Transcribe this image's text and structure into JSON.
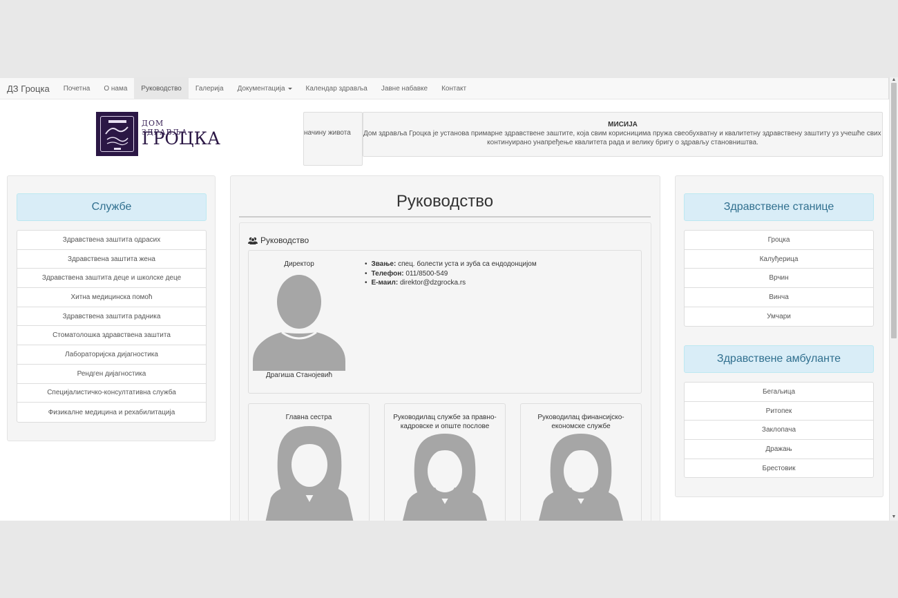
{
  "navbar": {
    "brand": "ДЗ Гроцка",
    "items": [
      {
        "label": "Почетна"
      },
      {
        "label": "О нама"
      },
      {
        "label": "Руководство"
      },
      {
        "label": "Галерија"
      },
      {
        "label": "Документација"
      },
      {
        "label": "Календар здравља"
      },
      {
        "label": "Јавне набавке"
      },
      {
        "label": "Контакт"
      }
    ],
    "active_index": 2
  },
  "logo": {
    "line1": "ДОМ ЗДРАВЉА",
    "line2": "ГРОЦКА"
  },
  "ticker": {
    "text": "начину живота"
  },
  "mission": {
    "title": "МИСИЈА",
    "line1": "Дом здравља Гроцка је установа примарне здравствене заштите, која свим корисницима пружа свеобухватну и квалитетну здравствену заштиту уз учешће свих посто",
    "line2": "континуирано унапређење квалитета рада и велику бригу о здрављу становништва."
  },
  "services": {
    "title": "Службе",
    "items": [
      {
        "label": "Здравствена заштита одрасих"
      },
      {
        "label": "Здравствена заштита жена"
      },
      {
        "label": "Здравствена заштита деце и школске деце"
      },
      {
        "label": "Хитна медицинска помоћ"
      },
      {
        "label": "Здравствена заштита радника"
      },
      {
        "label": "Стоматолошка здравствена заштита"
      },
      {
        "label": "Лабораторијска дијагностика"
      },
      {
        "label": "Рендген дијагностика"
      },
      {
        "label": "Специјалистичко-консултативна служба"
      },
      {
        "label": "Физикалне медицина и рехабилитација"
      }
    ]
  },
  "main": {
    "title": "Руководство",
    "section_title": "Руководство",
    "director": {
      "role": "Директор",
      "name": "Драгиша Станојевић",
      "rank_label": "Звање:",
      "rank": "спец. болести уста и зуба са ендодонцијом",
      "phone_label": "Телефон:",
      "phone": "011/8500-549",
      "email_label": "E-маил:",
      "email": "direktor@dzgrocka.rs"
    },
    "staff": [
      {
        "role": "Главна сестра"
      },
      {
        "role": "Руководилац службе за правно-кадровске и опште послове"
      },
      {
        "role": "Руководилац финансијско-економске службе"
      }
    ]
  },
  "stations": {
    "title": "Здравствене станице",
    "items": [
      {
        "label": "Гроцка"
      },
      {
        "label": "Калуђерица"
      },
      {
        "label": "Врчин"
      },
      {
        "label": "Винча"
      },
      {
        "label": "Умчари"
      }
    ]
  },
  "clinics": {
    "title": "Здравствене амбуланте",
    "items": [
      {
        "label": "Бегаљица"
      },
      {
        "label": "Ритопек"
      },
      {
        "label": "Заклопача"
      },
      {
        "label": "Дражањ"
      },
      {
        "label": "Брестовик"
      }
    ]
  },
  "colors": {
    "panel_head_bg": "#d9edf7",
    "panel_head_text": "#31708f",
    "avatar": "#a6a6a6",
    "logo": "#2b1745"
  }
}
